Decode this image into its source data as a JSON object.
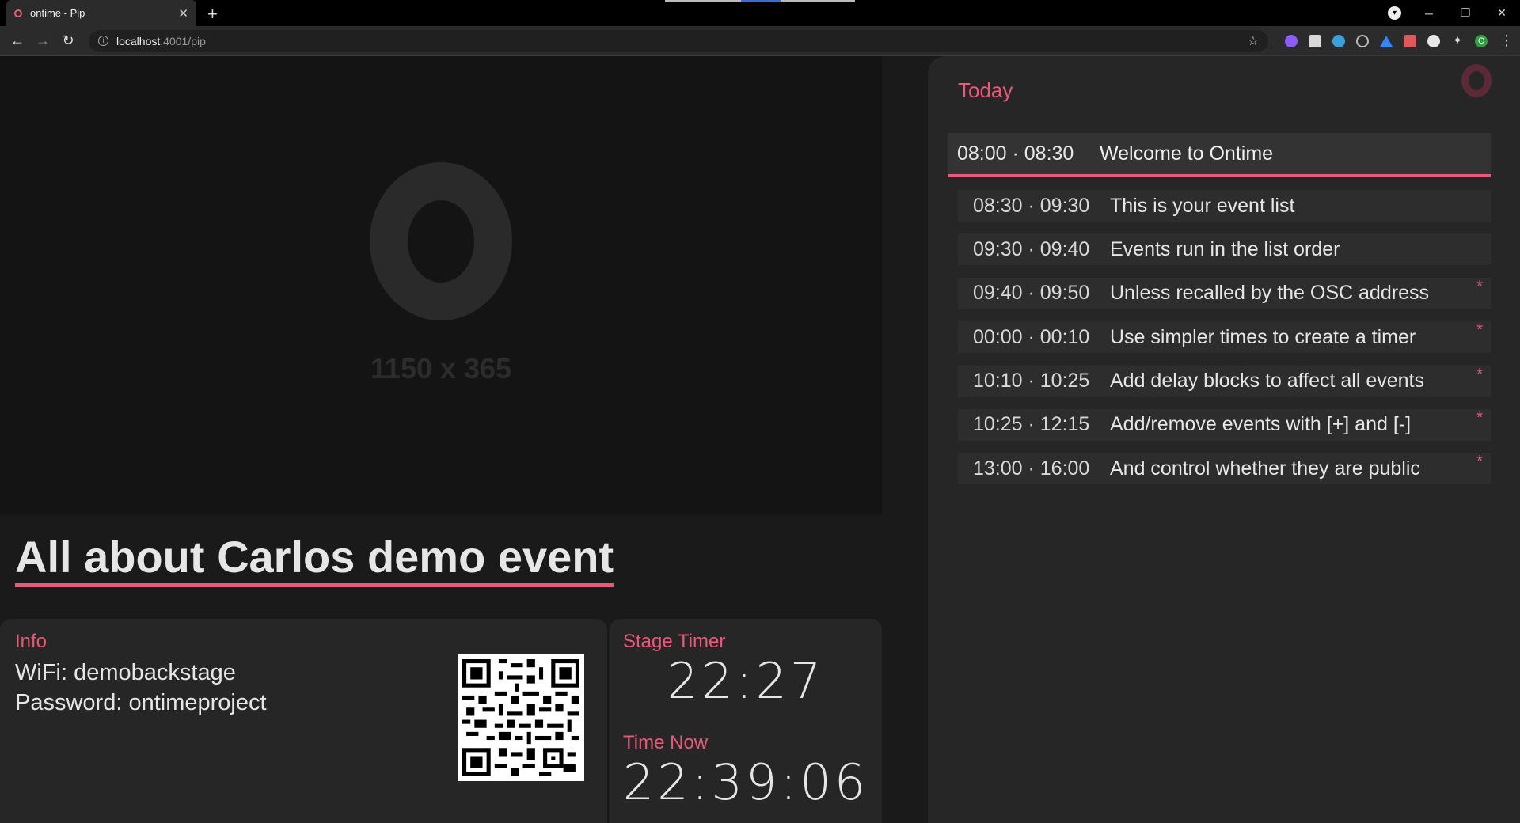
{
  "browser": {
    "tab_title": "ontime - Pip",
    "url_host": "localhost",
    "url_path": ":4001/pip",
    "profile_initial": "C"
  },
  "colors": {
    "accent": "#e85a7a",
    "panel": "#262626",
    "background": "#1a1a1a"
  },
  "placeholder": {
    "dimensions": "1150 x 365"
  },
  "event": {
    "title": "All about Carlos demo event"
  },
  "info": {
    "label": "Info",
    "line1": "WiFi: demobackstage",
    "line2": "Password: ontimeproject"
  },
  "timers": {
    "stage_label": "Stage Timer",
    "stage_value": "22:27",
    "now_label": "Time Now",
    "now_value": "22:39:06"
  },
  "schedule": {
    "label": "Today",
    "current": {
      "time": "08:00 · 08:30",
      "title": "Welcome to Ontime"
    },
    "events": [
      {
        "time": "08:30 · 09:30",
        "title": "This is your event list",
        "star": ""
      },
      {
        "time": "09:30 · 09:40",
        "title": "Events run in the list order",
        "star": ""
      },
      {
        "time": "09:40 · 09:50",
        "title": "Unless recalled by the OSC address",
        "star": "*"
      },
      {
        "time": "00:00 · 00:10",
        "title": "Use simpler times to create a timer",
        "star": "*"
      },
      {
        "time": "10:10 · 10:25",
        "title": "Add delay blocks to affect all events",
        "star": "*"
      },
      {
        "time": "10:25 · 12:15",
        "title": "Add/remove events with [+] and [-]",
        "star": "*"
      },
      {
        "time": "13:00 · 16:00",
        "title": "And control whether they are public",
        "star": "*"
      }
    ]
  }
}
